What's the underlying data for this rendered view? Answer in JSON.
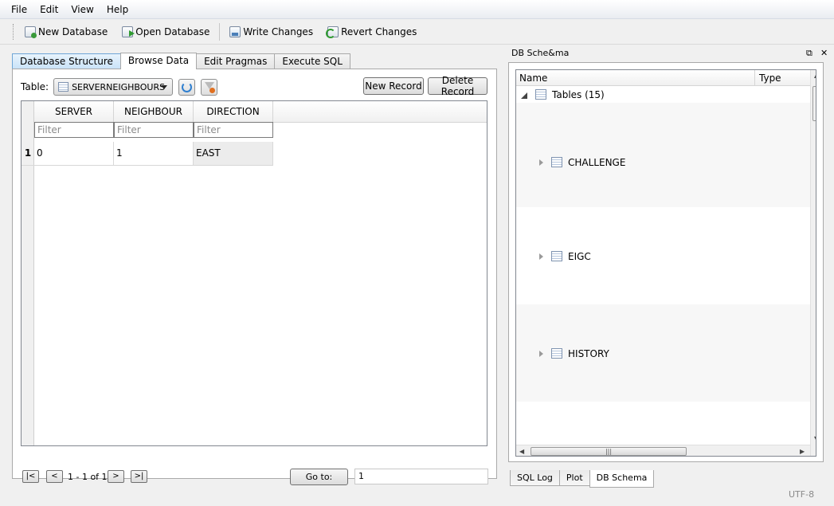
{
  "menu": [
    "File",
    "Edit",
    "View",
    "Help"
  ],
  "toolbar": {
    "new_db": "New Database",
    "open_db": "Open Database",
    "write": "Write Changes",
    "revert": "Revert Changes"
  },
  "tabs": [
    "Database Structure",
    "Browse Data",
    "Edit Pragmas",
    "Execute SQL"
  ],
  "browse": {
    "table_label": "Table:",
    "table_name": "SERVERNEIGHBOURS",
    "new_record": "New Record",
    "delete_record": "Delete Record",
    "columns": [
      "SERVER",
      "NEIGHBOUR",
      "DIRECTION"
    ],
    "filter_placeholder": "Filter",
    "rows": [
      {
        "num": "1",
        "cells": [
          "0",
          "1",
          "EAST"
        ]
      }
    ],
    "nav": {
      "first": "|<",
      "prev": "<",
      "range": "1 - 1 of 1",
      "next": ">",
      "last": ">|",
      "goto_label": "Go to:",
      "goto_value": "1"
    }
  },
  "dock": {
    "title": "DB Sche&ma",
    "tree": {
      "col_name": "Name",
      "col_type": "Type",
      "root": "Tables (15)",
      "items": [
        "CHALLENGE",
        "EIGC",
        "HISTORY"
      ]
    },
    "tabs": [
      "SQL Log",
      "Plot",
      "DB Schema"
    ]
  },
  "status": {
    "encoding": "UTF-8"
  }
}
